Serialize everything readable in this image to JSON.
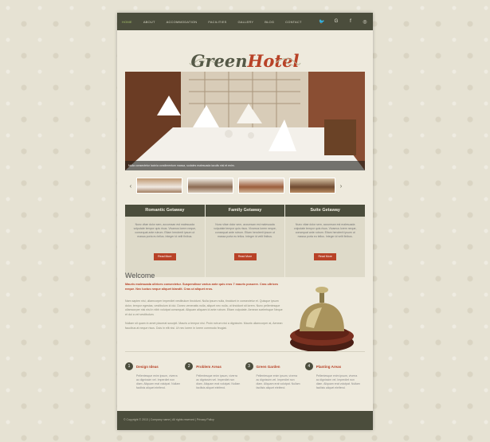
{
  "nav": {
    "items": [
      {
        "label": "HOME",
        "active": true
      },
      {
        "label": "ABOUT",
        "active": false
      },
      {
        "label": "ACCOMMODATION",
        "active": false
      },
      {
        "label": "FACILITIES",
        "active": false
      },
      {
        "label": "GALLERY",
        "active": false
      },
      {
        "label": "BLOG",
        "active": false
      },
      {
        "label": "CONTACT",
        "active": false
      }
    ],
    "socials": [
      {
        "icon": "twitter-icon",
        "glyph": "🐦"
      },
      {
        "icon": "google-icon",
        "glyph": "G"
      },
      {
        "icon": "facebook-icon",
        "glyph": "f"
      },
      {
        "icon": "dribbble-icon",
        "glyph": "◎"
      }
    ]
  },
  "logo": {
    "part1": "Green",
    "part2": "Hotel",
    "tagline": "Discover a world with us"
  },
  "slider": {
    "caption": "Nulla consectetur lacinia condimentum massa, sodales malesuada iaculis nisl et enim."
  },
  "features": [
    {
      "title": "Romantic Getaway",
      "text": "Nunc vitae dolor sem, accumsan est malesuada vulputate tempor quis risus. Vivamus lorem neque, consequat ante rutrum. Etiam hendrerit ipsum ut massa porta eu tellus. Integer id velit finibus.",
      "button": "Read More"
    },
    {
      "title": "Family Getaway",
      "text": "Nunc vitae dolor sem, accumsan est malesuada vulputate tempor quis risus. Vivamus lorem neque, consequat ante rutrum. Etiam hendrerit ipsum ut massa porta eu tellus. Integer id velit finibus.",
      "button": "Read More"
    },
    {
      "title": "Suite Getaway",
      "text": "Nunc vitae dolor sem, accumsan est malesuada vulputate tempor quis risus. Vivamus lorem neque, consequat ante rutrum. Etiam hendrerit ipsum ut massa porta eu tellus. Integer id velit finibus.",
      "button": "Read More"
    }
  ],
  "welcome": {
    "title": "Welcome",
    "lead": "Mauris malesuada ultrices consectetur. Suspendisse varius ante quis eros 7 mauris posuere. Cras ultrices neque. Nec luctus neque aliquet blandit. Cras ut aliquet eros.",
    "paragraphs": [
      "Nam sapien nisi, ullamcorper imperdiet vestibulum tincidunt. Nulla ipsum nulla, tincidunt in consectetur et. Quisque ipsum dolor, tempor egestas, vestibulum id dui. Donec venenatis nulla, aliquet nec nulla, ut tincidunt sit lorem. Nunc pellentesque ullamcorper nisi nisi in nibh volutpat consequat. Aliquam aliquam id ante rutrum. Etiam vulputate. Aenean scelerisque Neque et dui a vel vestibulum.",
      "Nullam sit quam in amet placerat suscipit. Mauris a tempor nisi. Proin rutrum nisi a dignissim. Mauris ullamcorper at, Aenean faucibus at neque risus. Duis in elit nisi. Ut nec lorem in lorem commodo feugiat."
    ]
  },
  "services": [
    {
      "num": "1",
      "title": "Design Ideas",
      "text": "Pellentesque enim ipsum, viverra ac dignissim vel. Imperdiet non diam. Aliquam erat volutpat. Nullam facilisis aliquet eleifend."
    },
    {
      "num": "2",
      "title": "Problem Areas",
      "text": "Pellentesque enim ipsum, viverra ac dignissim vel. Imperdiet non diam. Aliquam erat volutpat. Nullam facilisis aliquet eleifend."
    },
    {
      "num": "3",
      "title": "Green Garden",
      "text": "Pellentesque enim ipsum, viverra ac dignissim vel. Imperdiet non diam. Aliquam erat volutpat. Nullam facilisis aliquet eleifend."
    },
    {
      "num": "4",
      "title": "Planting Areas",
      "text": "Pellentesque enim ipsum, viverra ac dignissim vel. Imperdiet non diam. Aliquam erat volutpat. Nullam facilisis aliquet eleifend."
    }
  ],
  "footer": {
    "text": "© Copyright © 2013 | Company name | All rights reserved | Privacy Policy"
  },
  "colors": {
    "nav_bg": "#4b4d3c",
    "accent": "#b84227",
    "active_nav": "#a7c16a"
  }
}
